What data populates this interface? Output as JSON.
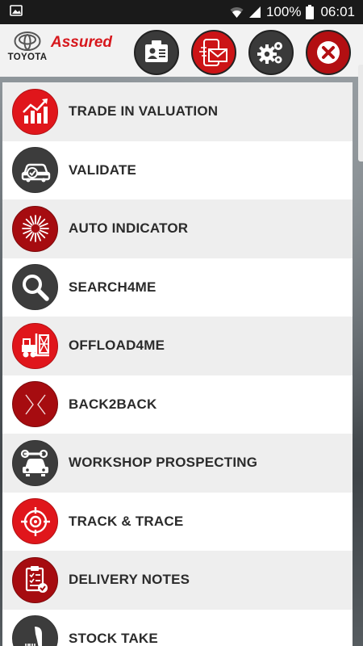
{
  "status": {
    "battery": "100%",
    "time": "06:01"
  },
  "header": {
    "toyota_label": "TOYOTA",
    "assured_label": "Assured",
    "buttons": [
      {
        "icon": "id-card-icon"
      },
      {
        "icon": "mobile-mail-icon"
      },
      {
        "icon": "gears-icon"
      },
      {
        "icon": "close-icon"
      }
    ]
  },
  "menu": {
    "items": [
      {
        "label": "TRADE IN VALUATION",
        "icon": "growth-chart-icon"
      },
      {
        "label": "VALIDATE",
        "icon": "car-check-icon"
      },
      {
        "label": "AUTO INDICATOR",
        "icon": "starburst-icon"
      },
      {
        "label": "SEARCH4ME",
        "icon": "magnifier-icon"
      },
      {
        "label": "OFFLOAD4ME",
        "icon": "forklift-icon"
      },
      {
        "label": "BACK2BACK",
        "icon": "cross-arrows-icon"
      },
      {
        "label": "WORKSHOP PROSPECTING",
        "icon": "car-wrench-icon"
      },
      {
        "label": "TRACK & TRACE",
        "icon": "target-icon"
      },
      {
        "label": "DELIVERY NOTES",
        "icon": "clipboard-check-icon"
      },
      {
        "label": "STOCK TAKE",
        "icon": "barcode-scanner-icon"
      }
    ]
  },
  "colors": {
    "brand_red": "#e0161b",
    "dark_circle": "#3c3c3c",
    "dark_red": "#a60c10"
  }
}
